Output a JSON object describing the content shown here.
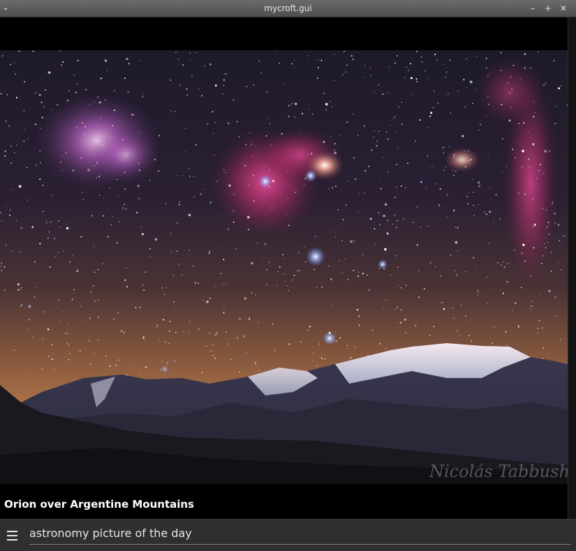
{
  "window": {
    "title": "mycroft.gui",
    "menu_icon": "chevron-down-icon",
    "buttons": [
      {
        "name": "minimize",
        "glyph": "–"
      },
      {
        "name": "maximize",
        "glyph": "+"
      },
      {
        "name": "close",
        "glyph": "✕"
      }
    ]
  },
  "picture": {
    "title": "Orion over Argentine Mountains",
    "watermark": "Nicolás Tabbush"
  },
  "query": {
    "text": "astronomy picture of the day",
    "menu_icon": "hamburger-menu-icon"
  }
}
